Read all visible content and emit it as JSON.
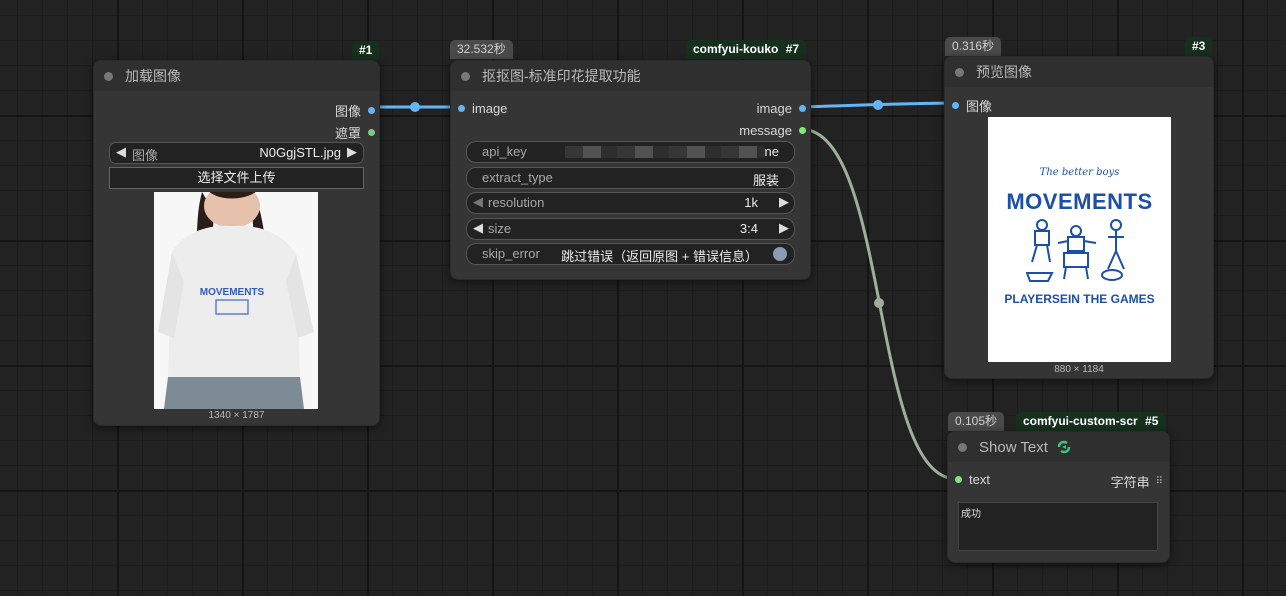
{
  "nodes": {
    "load_image": {
      "id_badge": "#1",
      "title": "加载图像",
      "outputs": [
        "图像",
        "遮罩"
      ],
      "image_widget": {
        "label": "图像",
        "value": "N0GgjSTL.jpg"
      },
      "upload_button": "选择文件上传",
      "image_size": "1340 × 1787",
      "shirt_text": "MOVEMENTS"
    },
    "cutout": {
      "time_badge": "32.532秒",
      "pack_badge": "comfyui-kouko",
      "id_badge": "#7",
      "title": "抠抠图-标准印花提取功能",
      "input": "image",
      "outputs": [
        "image",
        "message"
      ],
      "widgets": [
        {
          "label": "api_key",
          "value": "ne"
        },
        {
          "label": "extract_type",
          "value": "服装"
        },
        {
          "label": "resolution",
          "value": "1k"
        },
        {
          "label": "size",
          "value": "3:4"
        },
        {
          "label": "skip_error",
          "value": "跳过错误（返回原图 + 错误信息）"
        }
      ]
    },
    "preview": {
      "time_badge": "0.316秒",
      "id_badge": "#3",
      "title": "预览图像",
      "input": "图像",
      "image_size": "880 × 1184",
      "print": {
        "script": "The better boys",
        "headline": "MOVEMENTS",
        "footer": "PLAYERSEIN THE GAMES"
      }
    },
    "show_text": {
      "time_badge": "0.105秒",
      "pack_badge": "comfyui-custom-scr",
      "id_badge": "#5",
      "title": "Show Text",
      "input": "text",
      "output": "字符串",
      "text_value": "成功"
    }
  },
  "colors": {
    "image_link": "#64b5f6",
    "string_link": "#9eb09a",
    "node_bg": "#353535",
    "print_blue": "#1c4fa8"
  }
}
